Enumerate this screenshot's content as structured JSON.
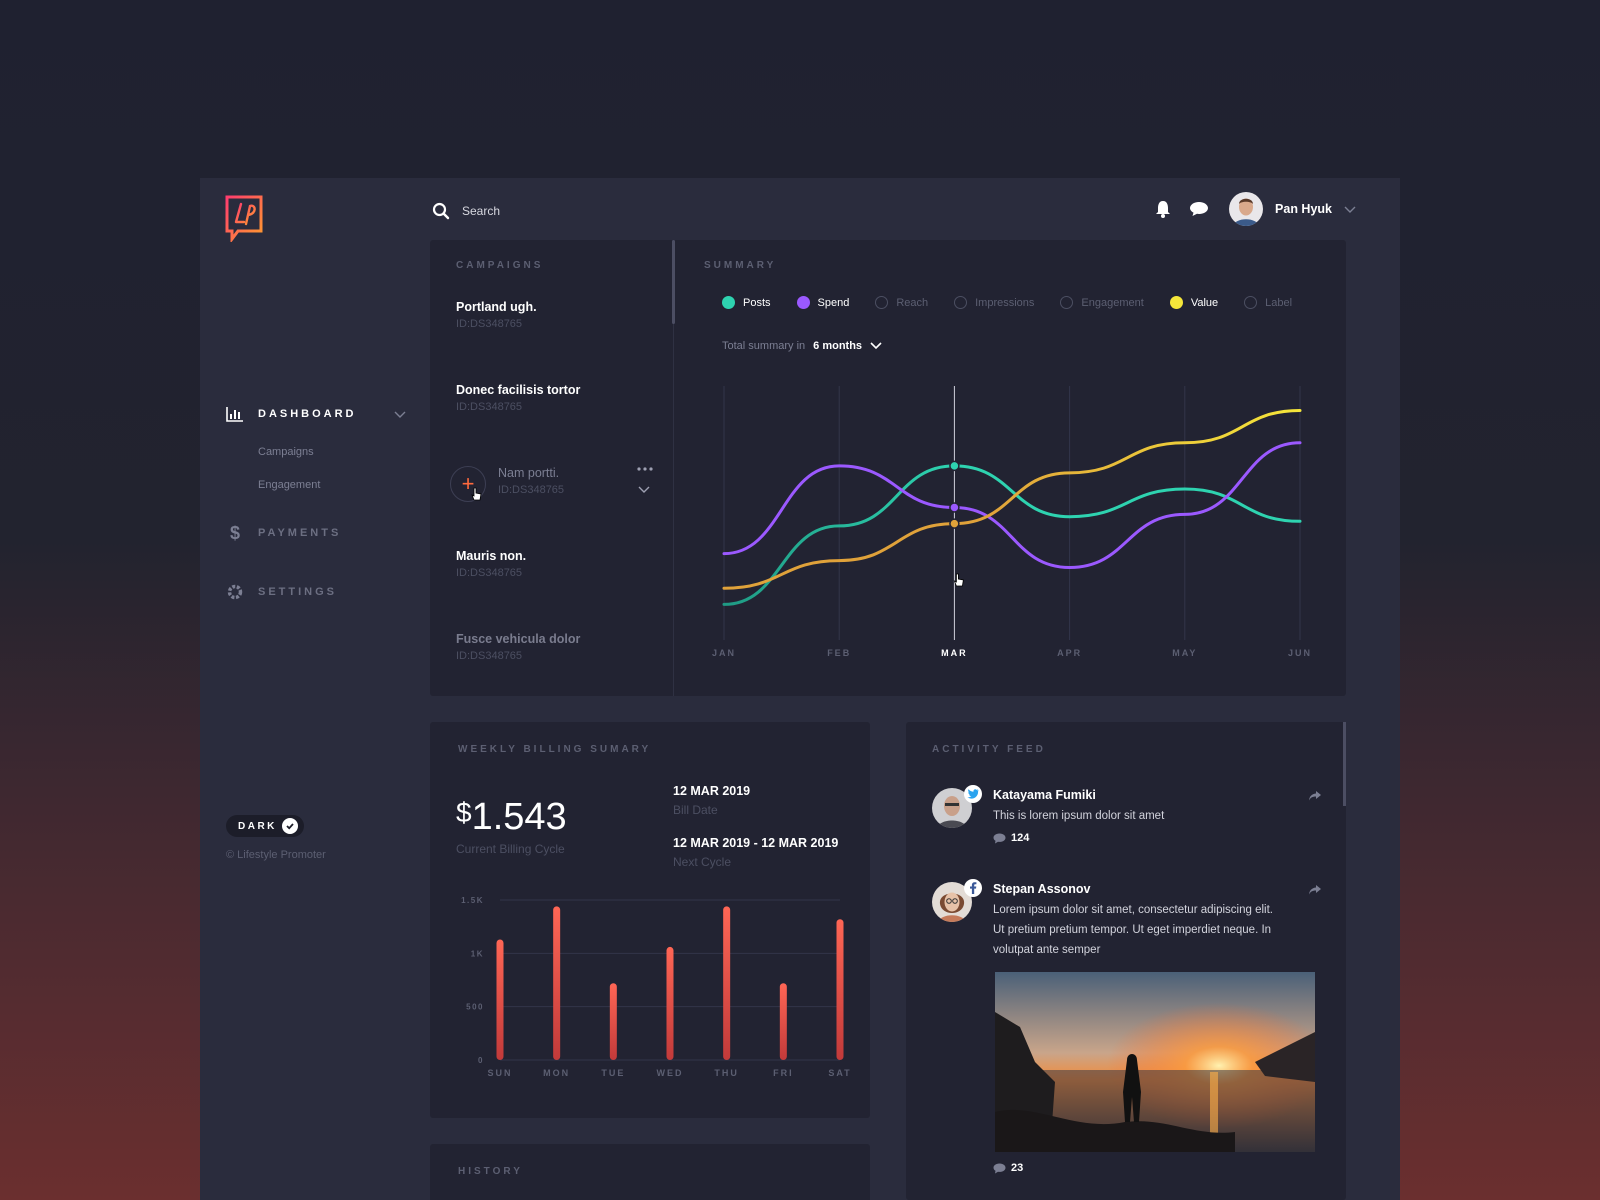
{
  "brand": {
    "logo_text": "LP",
    "copyright": "© Lifestyle Promoter"
  },
  "search": {
    "placeholder": "Search"
  },
  "user": {
    "name": "Pan Hyuk"
  },
  "nav": {
    "dashboard": "DASHBOARD",
    "sub": [
      "Campaigns",
      "Engagement"
    ],
    "payments": "PAYMENTS",
    "settings": "SETTINGS"
  },
  "theme_toggle": {
    "label": "DARK"
  },
  "campaigns": {
    "title": "CAMPAIGNS",
    "items": [
      {
        "name": "Portland ugh.",
        "id": "ID:DS348765"
      },
      {
        "name": "Donec facilisis tortor",
        "id": "ID:DS348765"
      },
      {
        "name": "Nam portti.",
        "id": "ID:DS348765"
      },
      {
        "name": "Mauris non.",
        "id": "ID:DS348765"
      },
      {
        "name": "Fusce vehicula dolor",
        "id": "ID:DS348765"
      }
    ]
  },
  "summary": {
    "title": "SUMMARY",
    "legend": [
      {
        "label": "Posts",
        "color": "#2ed3b0",
        "active": true
      },
      {
        "label": "Spend",
        "color": "#9b59ff",
        "active": true
      },
      {
        "label": "Reach",
        "active": false
      },
      {
        "label": "Impressions",
        "active": false
      },
      {
        "label": "Engagement",
        "active": false
      },
      {
        "label": "Value",
        "color": "#f5e63a",
        "active": true
      },
      {
        "label": "Label",
        "active": false
      }
    ],
    "total_label": "Total summary in",
    "total_period": "6 months"
  },
  "chart_data": [
    {
      "type": "line",
      "x": [
        "JAN",
        "FEB",
        "MAR",
        "APR",
        "MAY",
        "JUN"
      ],
      "highlight": "MAR",
      "series": [
        {
          "name": "Posts",
          "color": "#2ed3b0",
          "values": [
            18,
            52,
            78,
            56,
            68,
            54
          ]
        },
        {
          "name": "Spend",
          "color": "#9b59ff",
          "values": [
            40,
            78,
            60,
            34,
            57,
            88
          ]
        },
        {
          "name": "Value",
          "color": "#f5e63a",
          "values": [
            25,
            37,
            53,
            75,
            88,
            102
          ],
          "secondary_color": "#e0a23a"
        }
      ]
    },
    {
      "type": "bar",
      "categories": [
        "SUN",
        "MON",
        "TUE",
        "WED",
        "THU",
        "FRI",
        "SAT"
      ],
      "values": [
        1130,
        1440,
        720,
        1060,
        1440,
        720,
        1320
      ],
      "ylim": [
        0,
        1500
      ],
      "yticks": [
        "0",
        "500",
        "1K",
        "1.5K"
      ]
    }
  ],
  "billing": {
    "title": "WEEKLY BILLING SUMARY",
    "currency": "$",
    "amount": "1.543",
    "amount_label": "Current Billing Cycle",
    "bill_date": "12 MAR 2019",
    "bill_date_label": "Bill Date",
    "next_cycle": "12 MAR 2019 - 12 MAR 2019",
    "next_cycle_label": "Next Cycle"
  },
  "feed": {
    "title": "ACTIVITY FEED",
    "posts": [
      {
        "name": "Katayama Fumiki",
        "text": "This is lorem ipsum dolor sit amet",
        "comments": "124",
        "network": "twitter-icon"
      },
      {
        "name": "Stepan Assonov",
        "text": "Lorem ipsum dolor sit amet, consectetur adipiscing elit. Ut pretium pretium tempor. Ut eget imperdiet neque. In volutpat ante semper",
        "comments": "23",
        "network": "facebook-icon"
      }
    ]
  },
  "history": {
    "title": "HISTORY"
  }
}
